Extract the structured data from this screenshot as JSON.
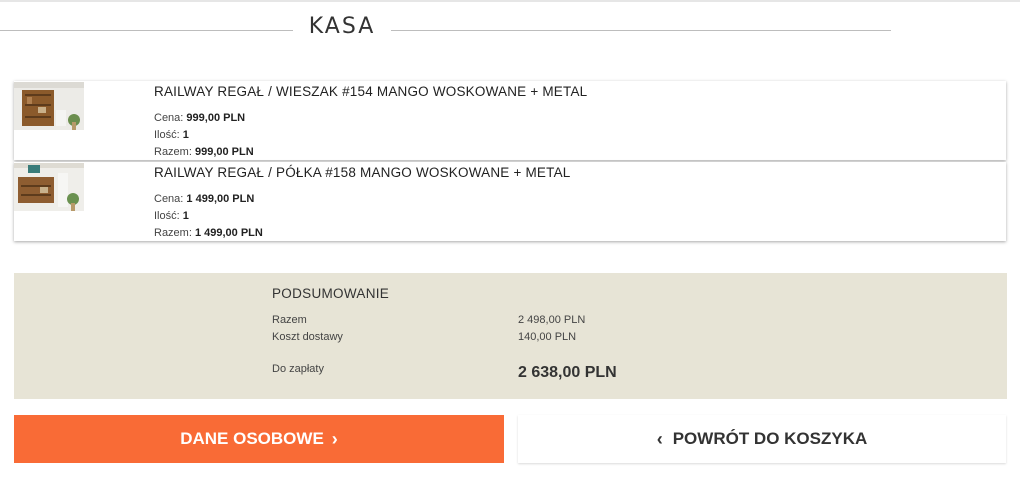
{
  "page": {
    "title": "KASA"
  },
  "items": [
    {
      "name": "RAILWAY REGAŁ / WIESZAK #154 MANGO WOSKOWANE + METAL",
      "price_label": "Cena:",
      "price": "999,00 PLN",
      "qty_label": "Ilość:",
      "qty": "1",
      "total_label": "Razem:",
      "total": "999,00 PLN"
    },
    {
      "name": "RAILWAY REGAŁ / PÓŁKA #158 MANGO WOSKOWANE + METAL",
      "price_label": "Cena:",
      "price": "1 499,00 PLN",
      "qty_label": "Ilość:",
      "qty": "1",
      "total_label": "Razem:",
      "total": "1 499,00 PLN"
    }
  ],
  "summary": {
    "title": "PODSUMOWANIE",
    "subtotal_label": "Razem",
    "subtotal": "2 498,00 PLN",
    "shipping_label": "Koszt dostawy",
    "shipping": "140,00 PLN",
    "pay_label": "Do zapłaty",
    "pay_total": "2 638,00 PLN"
  },
  "buttons": {
    "personal_data": "DANE OSOBOWE",
    "back_to_cart": "POWRÓT DO KOSZYKA"
  },
  "colors": {
    "accent": "#f96b36",
    "summary_bg": "#e7e4d6"
  },
  "icons": {
    "next": "chevron-right-icon",
    "back": "chevron-left-icon"
  }
}
